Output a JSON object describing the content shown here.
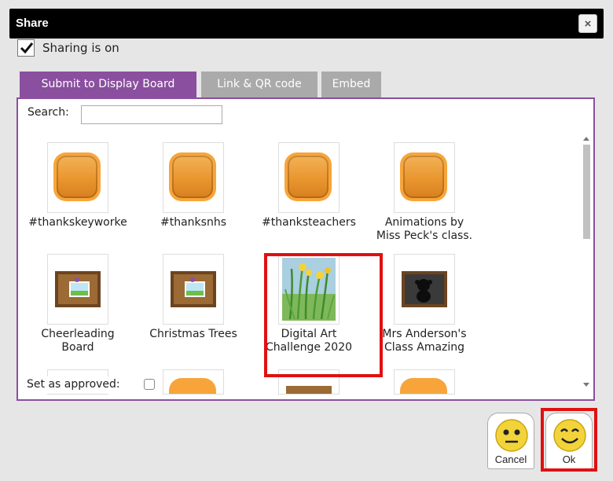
{
  "dialog": {
    "title": "Share",
    "close_label": "×"
  },
  "sharing": {
    "checked": true,
    "label": "Sharing is on"
  },
  "tabs": [
    {
      "label": "Submit to Display Board",
      "active": true
    },
    {
      "label": "Link & QR code",
      "active": false
    },
    {
      "label": "Embed",
      "active": false
    }
  ],
  "search": {
    "label": "Search:",
    "value": ""
  },
  "boards": [
    {
      "lines": [
        "#thankskeyworke"
      ],
      "icon": "orange-board-icon"
    },
    {
      "lines": [
        "#thanksnhs"
      ],
      "icon": "orange-board-icon"
    },
    {
      "lines": [
        "#thanksteachers"
      ],
      "icon": "orange-board-icon"
    },
    {
      "lines": [
        "Animations by",
        "Miss Peck's class."
      ],
      "icon": "orange-board-icon"
    },
    {
      "lines": [
        "Cheerleading",
        "Board"
      ],
      "icon": "corkboard-icon"
    },
    {
      "lines": [
        "Christmas Trees"
      ],
      "icon": "corkboard-icon"
    },
    {
      "lines": [
        "Digital Art",
        "Challenge 2020"
      ],
      "icon": "daffodil-art-icon",
      "highlighted": true
    },
    {
      "lines": [
        "Mrs Anderson's",
        "Class Amazing"
      ],
      "icon": "monkey-board-icon"
    }
  ],
  "approved": {
    "label": "Set as approved:",
    "checked": false
  },
  "buttons": {
    "cancel_label": "Cancel",
    "ok_label": "Ok"
  },
  "colors": {
    "accent": "#8a4f9e",
    "inactive_tab": "#aaaaaa",
    "highlight": "#e01010",
    "titlebar": "#000000"
  }
}
